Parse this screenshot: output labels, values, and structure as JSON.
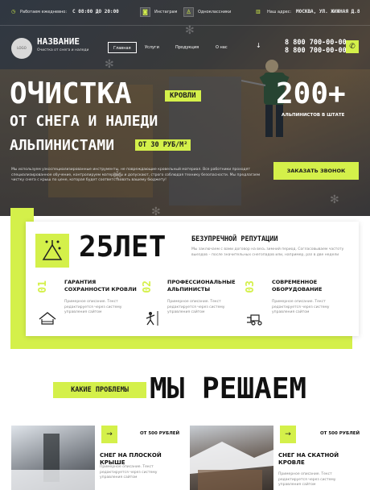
{
  "topbar": {
    "hours": "Работаем ежедневно:",
    "time": "С 08:00 ДО 20:00",
    "instagram_label": "Инстаграм",
    "vk_label": "Одноклассники",
    "address_label": "Наш адрес:",
    "address": "МОСКВА, УЛ. ЖИЖНАЯ Д.8"
  },
  "header": {
    "logo_text": "LOGO",
    "brand": "НАЗВАНИЕ",
    "brand_sub": "Очистка от снега и наледи",
    "menu": [
      "Главная",
      "Услуги",
      "Продукция",
      "О нас"
    ],
    "phones": [
      "8 800 700-00-00",
      "8 800 700-00-00"
    ]
  },
  "hero": {
    "line1": "ОЧИСТКА",
    "tag1": "КРОВЛИ",
    "line2": "ОТ СНЕГА И НАЛЕДИ",
    "line3": "АЛЬПИНИСТАМИ",
    "tag2": "ОТ 30 РУБ/М²",
    "stat_value": "200+",
    "stat_label": "АЛЬПИНИСТОВ В ШТАТЕ",
    "description": "Мы используем узкоспециализированные инструменты, не повреждающие кровельный материал. Все работники проходят специализированное обучение, контролируем материалы и допускают, строго соблюдая технику безопасности. Мы предлагаем чистку снега с крыш по цене, которая будет соответствовать вашему бюджету!",
    "cta": "ЗАКАЗАТЬ ЗВОНОК"
  },
  "advantages": {
    "years": "25ЛЕТ",
    "rep_title": "БЕЗУПРЕЧНОЙ РЕПУТАЦИИ",
    "rep_text": "Мы заключаем с вами договор на весь зимний период. Согласовываем частоту выездов – после значительных снегопадов или, например, раз в две недели",
    "items": [
      {
        "num": "01",
        "title": "ГАРАНТИЯ СОХРАННОСТИ КРОВЛИ",
        "text": "Примерное описание. Текст редактируется через систему управления сайтом",
        "icon": "roof-icon"
      },
      {
        "num": "02",
        "title": "ПРОФЕССИОНАЛЬНЫЕ АЛЬПИНИСТЫ",
        "text": "Примерное описание. Текст редактируется через систему управления сайтом",
        "icon": "climber-icon"
      },
      {
        "num": "03",
        "title": "СОВРЕМЕННОЕ ОБОРУДОВАНИЕ",
        "text": "Примерное описание. Текст редактируется через систему управления сайтом",
        "icon": "snowplow-icon"
      }
    ]
  },
  "problems": {
    "tag": "КАКИЕ ПРОБЛЕМЫ",
    "heading": "МЫ РЕШАЕМ",
    "services": [
      {
        "price": "ОТ 500 РУБЛЕЙ",
        "title": "СНЕГ НА ПЛОСКОЙ КРЫШЕ",
        "text": "Примерное описание. Текст редактируется через систему управления сайтом"
      },
      {
        "price": "ОТ 500 РУБЛЕЙ",
        "title": "СНЕГ НА СКАТНОЙ КРОВЛЕ",
        "text": "Примерное описание. Текст редактируется через систему управления сайтом"
      }
    ]
  },
  "colors": {
    "accent": "#d4f04a",
    "dark": "#1d1d1d"
  }
}
